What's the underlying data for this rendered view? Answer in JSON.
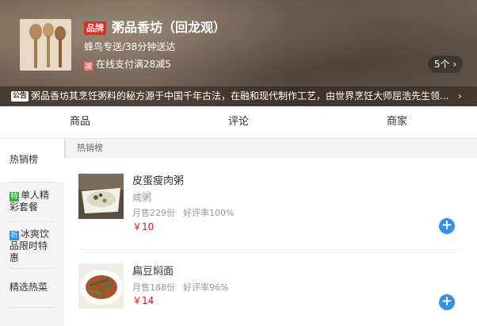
{
  "shop": {
    "brand_badge": "品牌",
    "name": "粥品香坊（回龙观）",
    "delivery": "蜂鸟专送/38分钟送达",
    "promo_icon": "减",
    "promo_text": "在线支付满28减5",
    "promo_count": "5个 ›"
  },
  "announcement": {
    "tag": "公告",
    "text": "粥品香坊其烹饪粥料的秘方源于中国千年古法，在融和现代制作工艺，由世界烹饪大师屈浩先生领...",
    "arrow": "›"
  },
  "tabs": [
    {
      "label": "商品"
    },
    {
      "label": "评论"
    },
    {
      "label": "商家"
    }
  ],
  "sidebar": {
    "items": [
      {
        "label": "热销榜",
        "tag": ""
      },
      {
        "label": "单人精彩套餐",
        "tag": "特",
        "tag_color": "#2db53c"
      },
      {
        "label": "冰爽饮品限时特惠",
        "tag": "折",
        "tag_color": "#3190e8"
      },
      {
        "label": "精选热菜",
        "tag": ""
      }
    ]
  },
  "section": {
    "title": "热销榜"
  },
  "foods": [
    {
      "name": "皮蛋瘦肉粥",
      "description": "咸粥",
      "sales": "月售229份",
      "rating": "好评率100%",
      "price": "￥10",
      "add_label": "+"
    },
    {
      "name": "扁豆焖面",
      "description": "",
      "sales": "月售188份",
      "rating": "好评率96%",
      "price": "￥14",
      "add_label": "+"
    }
  ],
  "colors": {
    "accent": "#3190e8",
    "price": "#f01414",
    "brand_badge": "#e02e24"
  }
}
